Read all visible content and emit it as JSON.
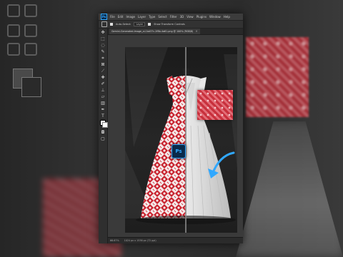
{
  "app": {
    "logo_text": "Ps",
    "menu": [
      "File",
      "Edit",
      "Image",
      "Layer",
      "Type",
      "Select",
      "Filter",
      "3D",
      "View",
      "Plugins",
      "Window",
      "Help"
    ]
  },
  "options_bar": {
    "auto_select_label": "Auto-Select:",
    "layer_value": "Layer",
    "show_transform_label": "Show Transform Controls"
  },
  "document": {
    "tab_title": "Gemini-Generated-Image_ai-1bd37c-2f8b-4a61.png @ 100% (RGB/8)",
    "close_glyph": "×"
  },
  "status": {
    "zoom": "66.67%",
    "info": "1024 px x 1536 px (72 ppi)"
  },
  "badge": {
    "label": "Ps"
  },
  "colors": {
    "ps_blue": "#31a8ff",
    "pattern_red": "#c8303c",
    "pattern_light": "#f4c8cc",
    "gown_white": "#f2f2f2"
  },
  "tools": [
    "move-tool",
    "artboard-tool",
    "marquee-tool",
    "lasso-tool",
    "quick-select-tool",
    "crop-tool",
    "frame-tool",
    "eyedropper-tool",
    "healing-brush-tool",
    "brush-tool",
    "clone-stamp-tool",
    "history-brush-tool",
    "eraser-tool",
    "gradient-tool",
    "blur-tool",
    "dodge-tool",
    "pen-tool",
    "type-tool",
    "path-select-tool",
    "rectangle-tool",
    "hand-tool",
    "zoom-tool"
  ]
}
